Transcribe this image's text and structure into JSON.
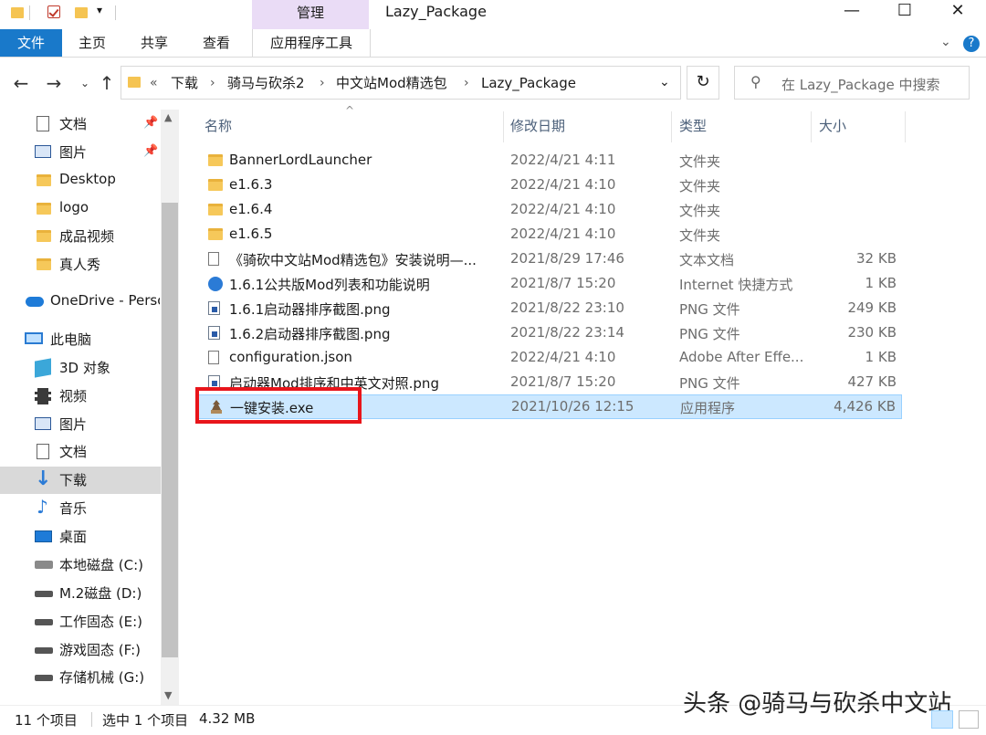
{
  "window": {
    "title": "Lazy_Package",
    "context_tab": "管理",
    "controls": {
      "minimize": "—",
      "maximize": "☐",
      "close": "✕"
    }
  },
  "ribbon": {
    "file_tab": "文件",
    "tabs": [
      "主页",
      "共享",
      "查看"
    ],
    "app_tools": "应用程序工具",
    "accent_color": "#1979ca",
    "context_color": "#eadcf6"
  },
  "address": {
    "prefix": "«",
    "crumbs": [
      "下载",
      "骑马与砍杀2",
      "中文站Mod精选包",
      "Lazy_Package"
    ],
    "search_placeholder": "在 Lazy_Package 中搜索"
  },
  "nav": {
    "quick_access": [
      {
        "label": "文档",
        "icon": "document-icon",
        "pinned": true
      },
      {
        "label": "图片",
        "icon": "pictures-icon",
        "pinned": true
      },
      {
        "label": "Desktop",
        "icon": "folder-icon"
      },
      {
        "label": "logo",
        "icon": "folder-icon"
      },
      {
        "label": "成品视频",
        "icon": "folder-icon"
      },
      {
        "label": "真人秀",
        "icon": "folder-icon"
      }
    ],
    "onedrive": "OneDrive - Perso",
    "this_pc": "此电脑",
    "pc_items": [
      {
        "label": "3D 对象",
        "icon": "3d-objects-icon"
      },
      {
        "label": "视频",
        "icon": "videos-icon"
      },
      {
        "label": "图片",
        "icon": "pictures-icon"
      },
      {
        "label": "文档",
        "icon": "document-icon"
      },
      {
        "label": "下载",
        "icon": "download-icon",
        "selected": true
      },
      {
        "label": "音乐",
        "icon": "music-icon"
      },
      {
        "label": "桌面",
        "icon": "desktop-icon"
      },
      {
        "label": "本地磁盘 (C:)",
        "icon": "system-drive-icon"
      },
      {
        "label": "M.2磁盘 (D:)",
        "icon": "drive-icon"
      },
      {
        "label": "工作固态 (E:)",
        "icon": "drive-icon"
      },
      {
        "label": "游戏固态 (F:)",
        "icon": "drive-icon"
      },
      {
        "label": "存储机械 (G:)",
        "icon": "drive-icon"
      }
    ]
  },
  "columns": {
    "name": "名称",
    "date": "修改日期",
    "type": "类型",
    "size": "大小"
  },
  "files": [
    {
      "name": "BannerLordLauncher",
      "date": "2022/4/21 4:11",
      "type": "文件夹",
      "size": "",
      "icon": "folder-icon"
    },
    {
      "name": "e1.6.3",
      "date": "2022/4/21 4:10",
      "type": "文件夹",
      "size": "",
      "icon": "folder-icon"
    },
    {
      "name": "e1.6.4",
      "date": "2022/4/21 4:10",
      "type": "文件夹",
      "size": "",
      "icon": "folder-icon"
    },
    {
      "name": "e1.6.5",
      "date": "2022/4/21 4:10",
      "type": "文件夹",
      "size": "",
      "icon": "folder-icon"
    },
    {
      "name": "《骑砍中文站Mod精选包》安装说明—...",
      "date": "2021/8/29 17:46",
      "type": "文本文档",
      "size": "32 KB",
      "icon": "text-file-icon"
    },
    {
      "name": "1.6.1公共版Mod列表和功能说明",
      "date": "2021/8/7 15:20",
      "type": "Internet 快捷方式",
      "size": "1 KB",
      "icon": "internet-shortcut-icon"
    },
    {
      "name": "1.6.1启动器排序截图.png",
      "date": "2021/8/22 23:10",
      "type": "PNG 文件",
      "size": "249 KB",
      "icon": "png-file-icon"
    },
    {
      "name": "1.6.2启动器排序截图.png",
      "date": "2021/8/22 23:14",
      "type": "PNG 文件",
      "size": "230 KB",
      "icon": "png-file-icon"
    },
    {
      "name": "configuration.json",
      "date": "2022/4/21 4:10",
      "type": "Adobe After Effe...",
      "size": "1 KB",
      "icon": "json-file-icon"
    },
    {
      "name": "启动器Mod排序和中英文对照.png",
      "date": "2021/8/7 15:20",
      "type": "PNG 文件",
      "size": "427 KB",
      "icon": "png-file-icon"
    },
    {
      "name": "一键安装.exe",
      "date": "2021/10/26 12:15",
      "type": "应用程序",
      "size": "4,426 KB",
      "icon": "exe-file-icon",
      "selected": true
    }
  ],
  "status": {
    "item_count": "11 个项目",
    "selection": "选中 1 个项目",
    "selection_size": "4.32 MB"
  },
  "watermark": "头条 @骑马与砍杀中文站",
  "highlight_color": "#e8151b"
}
